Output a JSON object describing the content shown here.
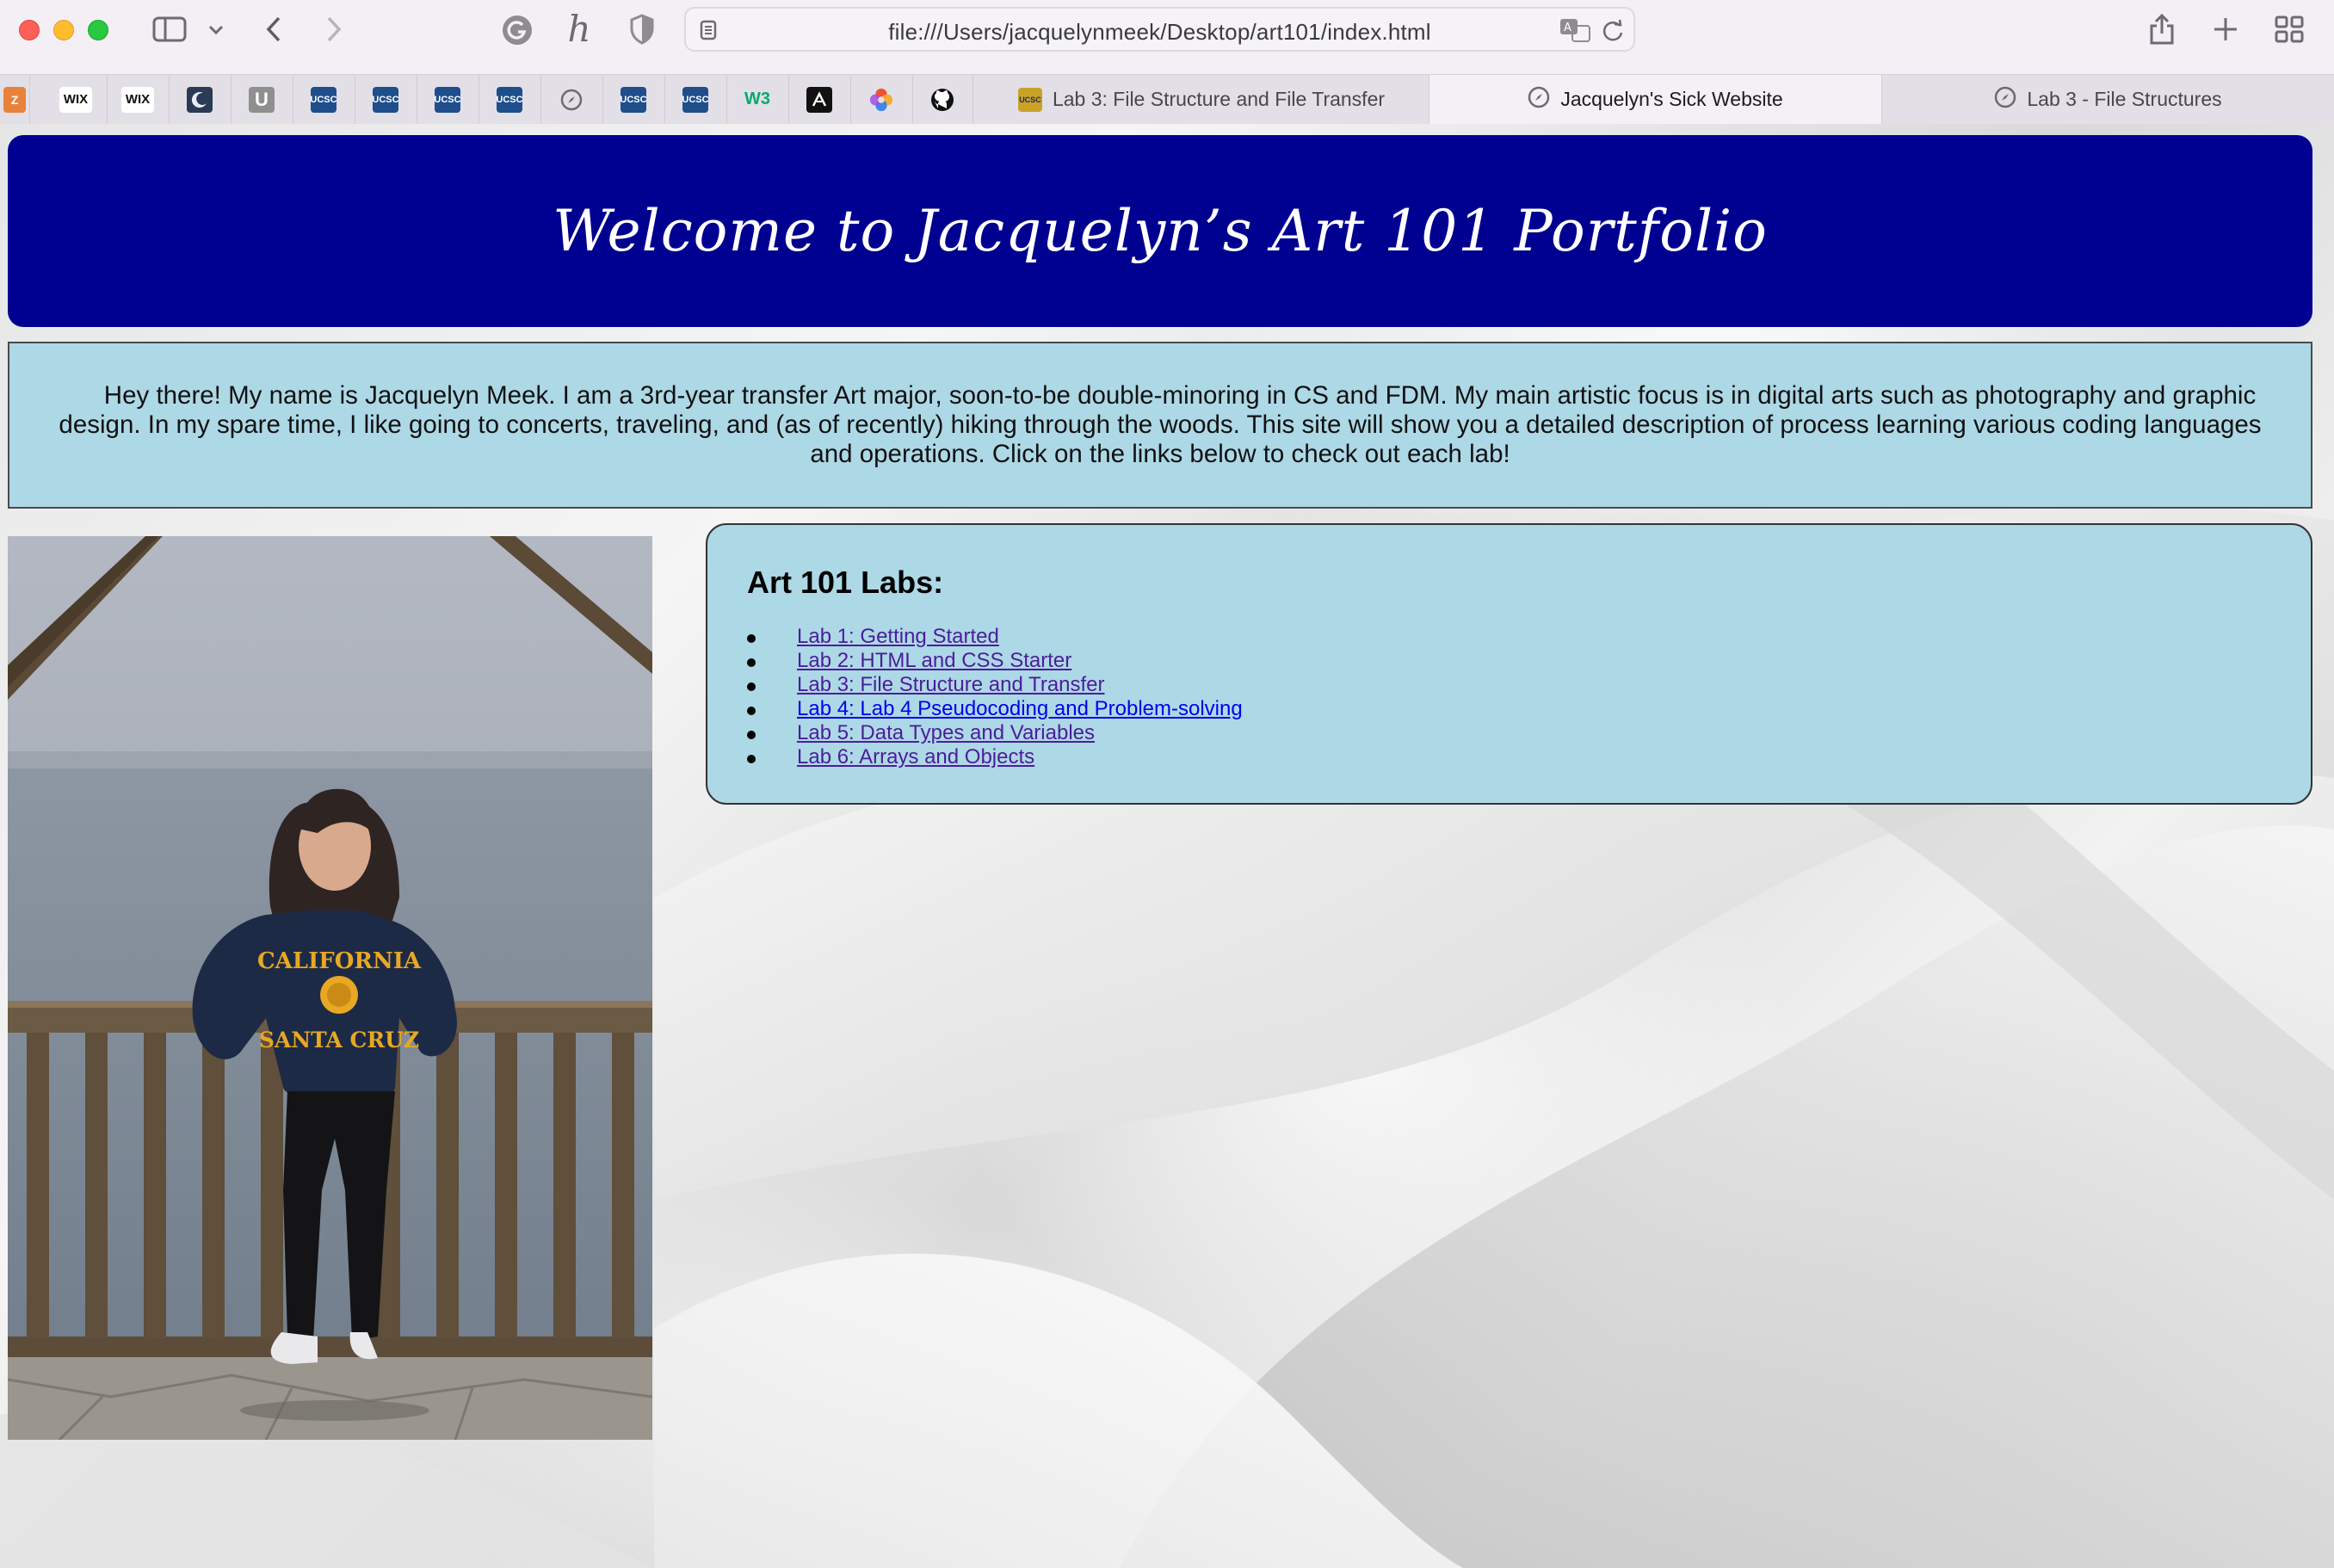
{
  "browser": {
    "url": "file:///Users/jacquelynmeek/Desktop/art101/index.html",
    "favorites": [
      {
        "icon": "zotero-icon",
        "label": "Z",
        "color": "#e8823a"
      },
      {
        "icon": "wix-icon",
        "label": "WIX",
        "color": "#ffffff"
      },
      {
        "icon": "wix-icon",
        "label": "WIX",
        "color": "#ffffff"
      },
      {
        "icon": "moon-icon",
        "label": "",
        "color": "#2b3a55"
      },
      {
        "icon": "u-icon",
        "label": "U",
        "color": "#8f8f8f"
      },
      {
        "icon": "ucsc-icon",
        "label": "UCSC",
        "color": "#1f4e8c"
      },
      {
        "icon": "ucsc-icon",
        "label": "UCSC",
        "color": "#1f4e8c"
      },
      {
        "icon": "ucsc-icon",
        "label": "UCSC",
        "color": "#1f4e8c"
      },
      {
        "icon": "ucsc-icon",
        "label": "UCSC",
        "color": "#1f4e8c"
      },
      {
        "icon": "compass-icon",
        "label": "",
        "color": "#e3dfe6"
      },
      {
        "icon": "ucsc-icon",
        "label": "UCSC",
        "color": "#1f4e8c"
      },
      {
        "icon": "ucsc-icon",
        "label": "UCSC",
        "color": "#1f4e8c"
      },
      {
        "icon": "w3-icon",
        "label": "W3",
        "color": "#ffffff"
      },
      {
        "icon": "adobe-icon",
        "label": "",
        "color": "#111111"
      },
      {
        "icon": "spiral-icon",
        "label": "",
        "color": "#ffffff"
      },
      {
        "icon": "github-icon",
        "label": "",
        "color": "#ffffff"
      }
    ],
    "tabs": [
      {
        "label": "Lab 3: File Structure and File Transfer",
        "active": false
      },
      {
        "label": "Jacquelyn's Sick Website",
        "active": true
      },
      {
        "label": "Lab 3 - File Structures",
        "active": false
      }
    ]
  },
  "page": {
    "title": "Welcome to Jacquelyn’s Art 101 Portfolio",
    "intro": "Hey there! My name is Jacquelyn Meek. I am a 3rd-year transfer Art major, soon-to-be double-minoring in CS and FDM. My main artistic focus is in digital arts such as photography and graphic design. In my spare time, I like going to concerts, traveling, and (as of recently) hiking through the woods. This site will show you a detailed description of process learning various coding languages and operations. Click on the links below to check out each lab!",
    "labs_heading": "Art 101 Labs:",
    "labs": [
      {
        "label": "Lab 1: Getting Started",
        "visited": true
      },
      {
        "label": "Lab 2: HTML and CSS Starter",
        "visited": true
      },
      {
        "label": "Lab 3: File Structure and Transfer",
        "visited": true
      },
      {
        "label": "Lab 4: Lab 4 Pseudocoding and Problem-solving",
        "visited": false
      },
      {
        "label": "Lab 5: Data Types and Variables",
        "visited": true
      },
      {
        "label": "Lab 6: Arrays and Objects",
        "visited": true
      }
    ],
    "photo_sweatshirt_text": [
      "CALIFORNIA",
      "SANTA CRUZ"
    ],
    "colors": {
      "header_bg": "#000090",
      "box_bg": "#add8e6",
      "link": "#4b1d9c",
      "link_new": "#0000ee"
    }
  }
}
